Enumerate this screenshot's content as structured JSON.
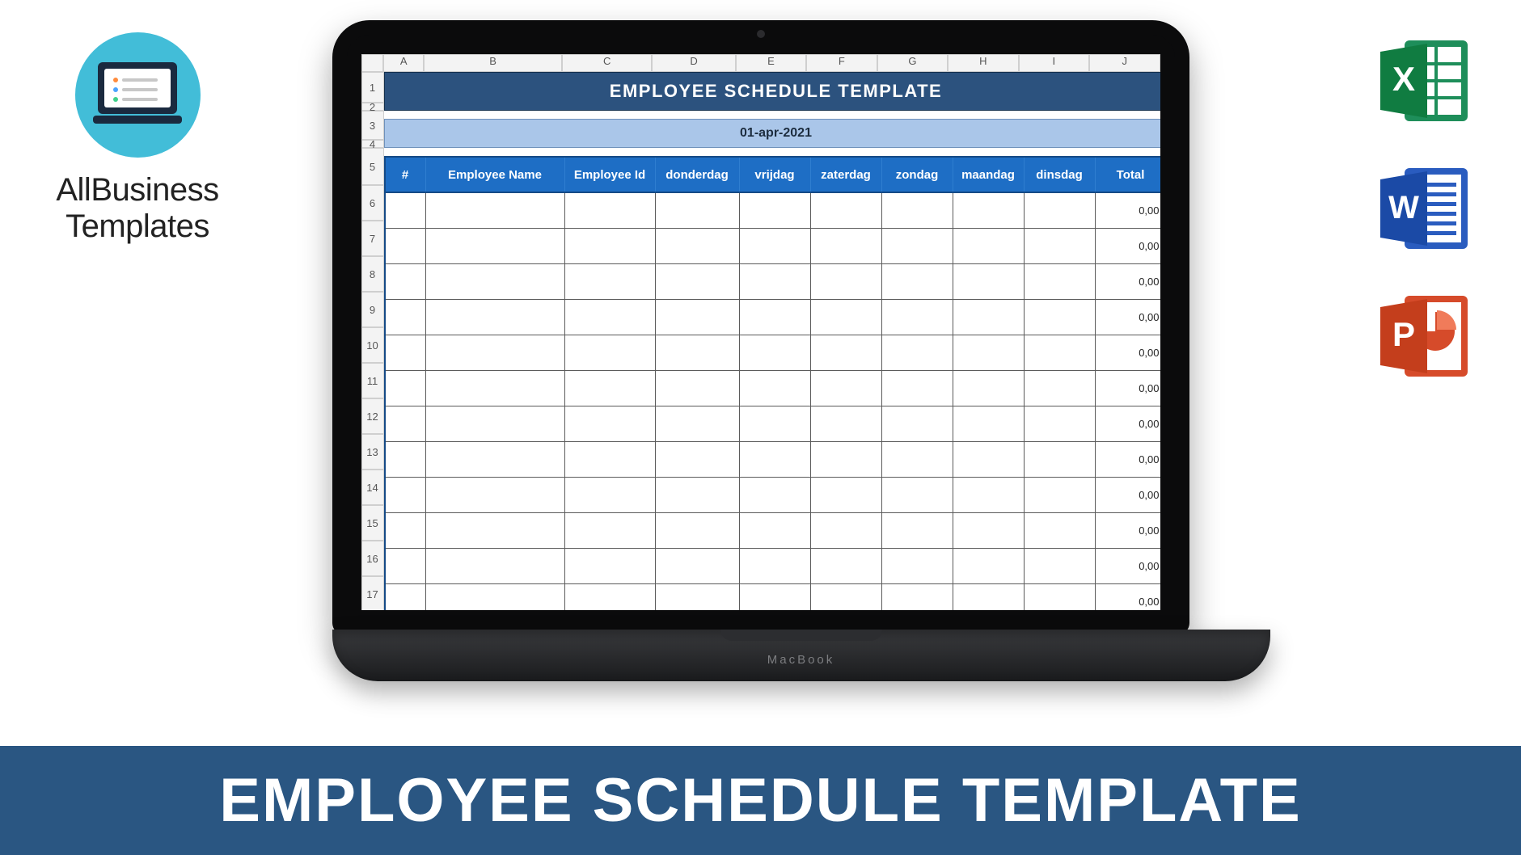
{
  "brand": {
    "line1": "AllBusiness",
    "line2": "Templates"
  },
  "office_icons": {
    "excel": "excel-icon",
    "word": "word-icon",
    "powerpoint": "powerpoint-icon"
  },
  "banner": {
    "text": "EMPLOYEE SCHEDULE TEMPLATE"
  },
  "laptop": {
    "label": "MacBook"
  },
  "spreadsheet": {
    "column_letters": [
      "A",
      "B",
      "C",
      "D",
      "E",
      "F",
      "G",
      "H",
      "I",
      "J"
    ],
    "row_numbers": [
      "1",
      "2",
      "3",
      "4",
      "5",
      "6",
      "7",
      "8",
      "9",
      "10",
      "11",
      "12",
      "13",
      "14",
      "15",
      "16",
      "17"
    ],
    "title": "EMPLOYEE SCHEDULE TEMPLATE",
    "date": "01-apr-2021",
    "headers": {
      "num": "#",
      "employee_name": "Employee Name",
      "employee_id": "Employee Id",
      "day1": "donderdag",
      "day2": "vrijdag",
      "day3": "zaterdag",
      "day4": "zondag",
      "day5": "maandag",
      "day6": "dinsdag",
      "total": "Total"
    },
    "rows": [
      {
        "total": "0,00"
      },
      {
        "total": "0,00"
      },
      {
        "total": "0,00"
      },
      {
        "total": "0,00"
      },
      {
        "total": "0,00"
      },
      {
        "total": "0,00"
      },
      {
        "total": "0,00"
      },
      {
        "total": "0,00"
      },
      {
        "total": "0,00"
      },
      {
        "total": "0,00"
      },
      {
        "total": "0,00"
      },
      {
        "total": "0,00"
      }
    ]
  }
}
